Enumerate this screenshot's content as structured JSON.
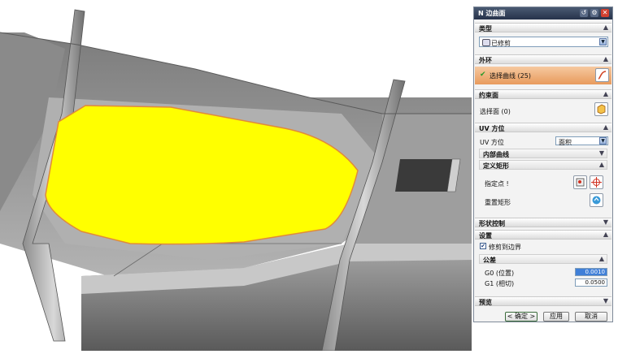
{
  "dialog": {
    "title": "N 边曲面",
    "sections": {
      "type": {
        "label": "类型",
        "value": "已修剪"
      },
      "outer_loop": {
        "label": "外环",
        "select_label": "选择曲线 (25)"
      },
      "constraint": {
        "label": "约束面",
        "select_label": "选择面 (0)"
      },
      "uv": {
        "label": "UV 方位",
        "field_label": "UV 方位",
        "value": "面积",
        "inner_curves": "内部曲线",
        "define_rect": "定义矩形",
        "specify_point": "指定点 !",
        "reset_rect": "重置矩形"
      },
      "shape": {
        "label": "形状控制"
      },
      "settings": {
        "label": "设置",
        "trim_label": "修剪到边界",
        "tolerance": "公差",
        "g0_label": "G0 (位置)",
        "g0_value": "0.0010",
        "g1_label": "G1 (相切)",
        "g1_value": "0.0500"
      },
      "preview": {
        "label": "预览"
      }
    },
    "buttons": {
      "ok": "< 确定 >",
      "apply": "应用",
      "cancel": "取消"
    }
  },
  "colors": {
    "highlight": "#ffff00",
    "accent": "#e8a060",
    "titlebar": "#2f3b52",
    "model": "#9a9a9a"
  }
}
